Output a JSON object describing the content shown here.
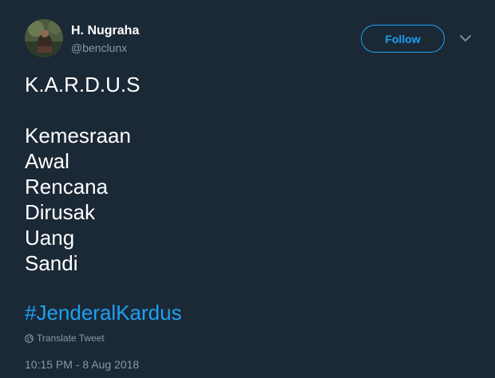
{
  "user": {
    "name": "H. Nugraha",
    "handle": "@benclunx",
    "follow_label": "Follow"
  },
  "tweet": {
    "lines": [
      "K.A.R.D.U.S",
      "",
      "Kemesraan",
      "Awal",
      "Rencana",
      "Dirusak",
      "Uang",
      "Sandi"
    ],
    "hashtag": "#JenderalKardus",
    "translate_label": "Translate Tweet",
    "timestamp": "10:15 PM - 8 Aug 2018"
  },
  "icons": {
    "menu": "chevron-down-icon",
    "translate": "globe-icon"
  },
  "colors": {
    "background": "#1b2836",
    "accent": "#1da1f2",
    "muted": "#8899a6",
    "text": "#ffffff"
  }
}
